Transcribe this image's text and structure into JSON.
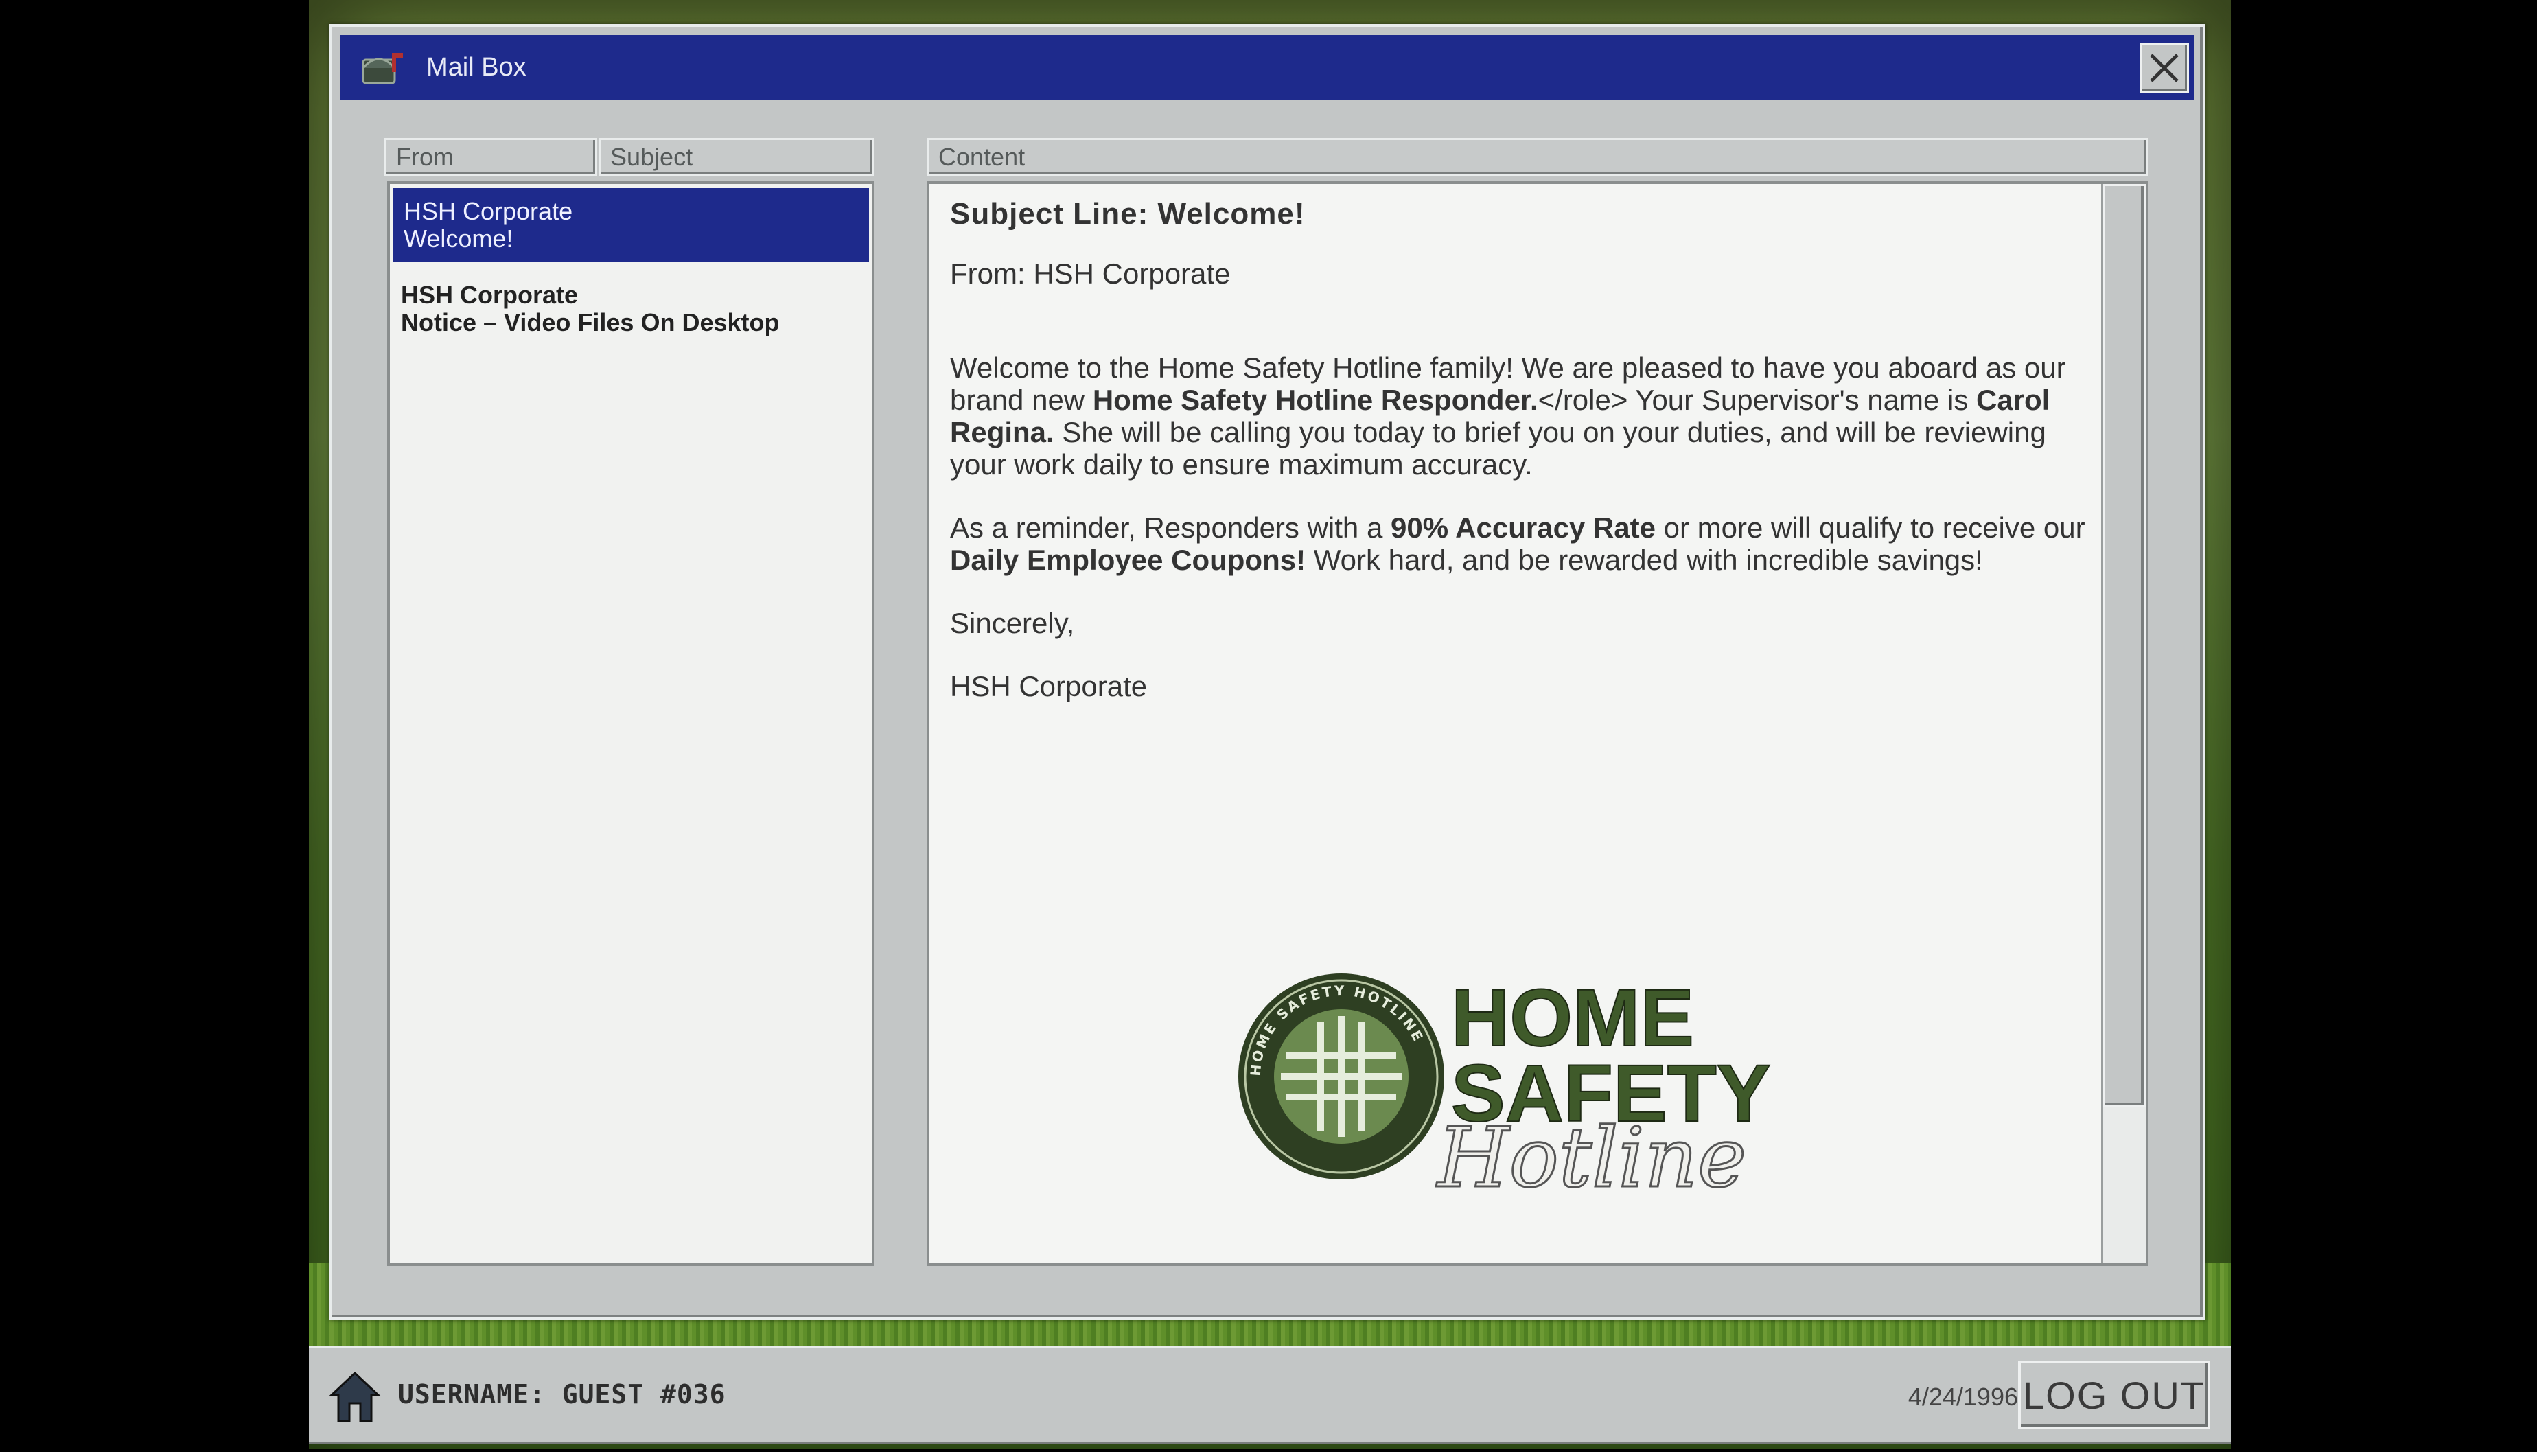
{
  "window": {
    "title": "Mail Box"
  },
  "list": {
    "columns": [
      "From",
      "Subject"
    ],
    "items": [
      {
        "from": "HSH Corporate",
        "subject": "Welcome!",
        "selected": true
      },
      {
        "from": "HSH Corporate",
        "subject": "Notice – Video Files On Desktop",
        "selected": false
      }
    ]
  },
  "content": {
    "header": "Content",
    "subject_line": "Subject Line: Welcome!",
    "from_line": "From: HSH Corporate",
    "para1_a": "Welcome to the Home Safety Hotline family! We are pleased to have you aboard as our brand new ",
    "para1_b": "Home Safety Hotline Responder.",
    "para1_c": "</role> Your Supervisor's name is ",
    "para1_d": "Carol Regina.",
    "para1_e": " She will be calling you today to brief you on your duties, and will be reviewing your work daily to ensure maximum accuracy.",
    "para2_a": "As a reminder, Responders with a ",
    "para2_b": "90% Accuracy Rate",
    "para2_c": " or more will qualify to receive our ",
    "para2_d": "Daily Employee Coupons!",
    "para2_e": " Work hard, and be rewarded with incredible savings!",
    "closing": "Sincerely,",
    "signature": "HSH Corporate",
    "logo_text": [
      "HOME",
      "SAFETY",
      "Hotline"
    ],
    "seal_text": "HOME SAFETY HOTLINE"
  },
  "taskbar": {
    "username": "USERNAME: GUEST #036",
    "date": "4/24/1996",
    "logout_label": "LOG OUT"
  },
  "colors": {
    "titlebar": "#1e2a8c",
    "window": "#c3c6c6",
    "pane": "#f4f5f3",
    "logo_green": "#3f5a2a"
  }
}
